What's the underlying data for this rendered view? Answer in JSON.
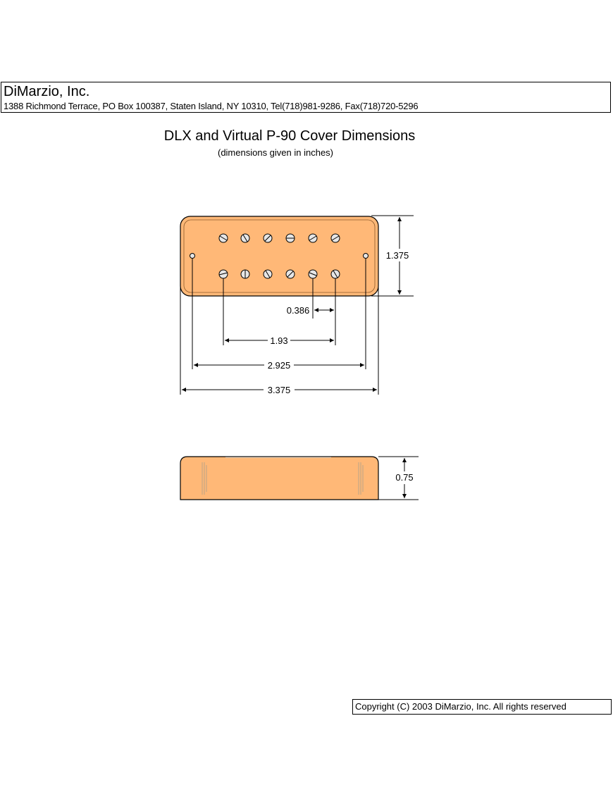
{
  "header": {
    "company": "DiMarzio, Inc.",
    "address": "1388 Richmond Terrace, PO Box 100387, Staten Island, NY 10310, Tel(718)981-9286, Fax(718)720-5296"
  },
  "title": "DLX and Virtual P-90 Cover Dimensions",
  "subtitle": "(dimensions given in inches)",
  "top_view": {
    "dimensions": {
      "height": "1.375",
      "pole_spacing": "0.386",
      "pole_span": "1.93",
      "mount_hole_span": "2.925",
      "overall_length": "3.375"
    }
  },
  "side_view": {
    "dimensions": {
      "depth": "0.75"
    }
  },
  "colors": {
    "cover": "#FFB877",
    "outline": "#000000"
  },
  "copyright": "Copyright (C) 2003 DiMarzio, Inc. All rights reserved"
}
